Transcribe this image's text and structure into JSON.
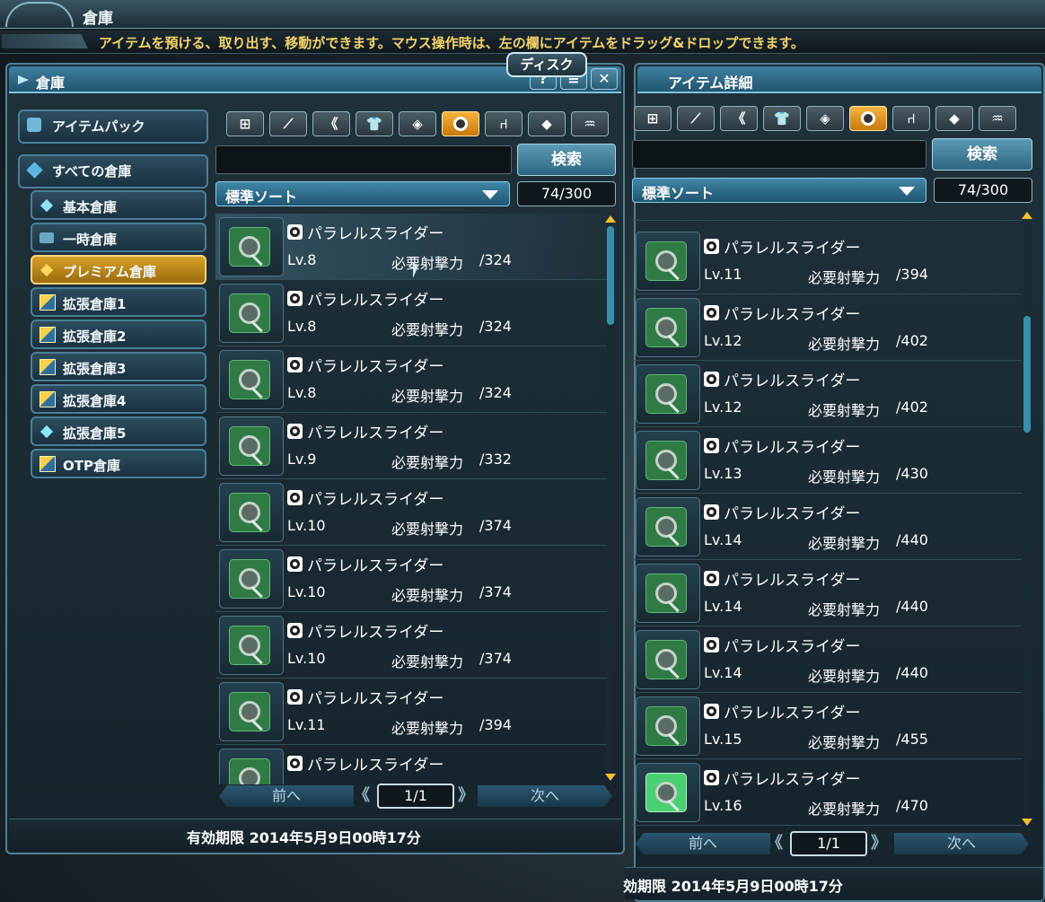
{
  "topbar": {
    "title": "倉庫"
  },
  "info": {
    "text": "アイテムを預ける、取り出す、移動ができます。マウス操作時は、左の欄にアイテムをドラッグ&ドロップできます。"
  },
  "tooltip": {
    "text": "ディスク"
  },
  "left": {
    "title": "倉庫",
    "controls": {
      "help": "?",
      "menu": "≡",
      "close": "✕"
    },
    "sidebar": [
      {
        "label": "アイテムパック",
        "icon": "item-pack-icon"
      },
      {
        "label": "すべての倉庫",
        "icon": "all-storage-icon"
      },
      {
        "label": "基本倉庫",
        "icon": "diamond-icon"
      },
      {
        "label": "一時倉庫",
        "icon": "temp-storage-icon"
      },
      {
        "label": "プレミアム倉庫",
        "icon": "premium-icon",
        "active": true
      },
      {
        "label": "拡張倉庫1",
        "icon": "expansion-icon"
      },
      {
        "label": "拡張倉庫2",
        "icon": "expansion-icon"
      },
      {
        "label": "拡張倉庫3",
        "icon": "expansion-icon"
      },
      {
        "label": "拡張倉庫4",
        "icon": "expansion-icon"
      },
      {
        "label": "拡張倉庫5",
        "icon": "diamond-icon"
      },
      {
        "label": "OTP倉庫",
        "icon": "expansion-icon"
      }
    ],
    "search_button": "検索",
    "sort_label": "標準ソート",
    "count": "74/300",
    "items": [
      {
        "name": "パラレルスライダー",
        "lv": "Lv.8",
        "req": "必要射撃力",
        "val": "/324"
      },
      {
        "name": "パラレルスライダー",
        "lv": "Lv.8",
        "req": "必要射撃力",
        "val": "/324"
      },
      {
        "name": "パラレルスライダー",
        "lv": "Lv.8",
        "req": "必要射撃力",
        "val": "/324"
      },
      {
        "name": "パラレルスライダー",
        "lv": "Lv.9",
        "req": "必要射撃力",
        "val": "/332"
      },
      {
        "name": "パラレルスライダー",
        "lv": "Lv.10",
        "req": "必要射撃力",
        "val": "/374"
      },
      {
        "name": "パラレルスライダー",
        "lv": "Lv.10",
        "req": "必要射撃力",
        "val": "/374"
      },
      {
        "name": "パラレルスライダー",
        "lv": "Lv.10",
        "req": "必要射撃力",
        "val": "/374"
      },
      {
        "name": "パラレルスライダー",
        "lv": "Lv.11",
        "req": "必要射撃力",
        "val": "/394"
      },
      {
        "name": "パラレルスライダー",
        "lv": "",
        "req": "",
        "val": ""
      }
    ],
    "pager": {
      "prev": "前へ",
      "page": "1/1",
      "next": "次へ"
    },
    "expiry": "有効期限 2014年5月9日00時17分"
  },
  "right": {
    "title": "アイテム詳細",
    "search_button": "検索",
    "sort_label": "標準ソート",
    "count": "74/300",
    "items": [
      {
        "name": "パラレルスライダー",
        "lv": "Lv.11",
        "req": "必要射撃力",
        "val": "/394"
      },
      {
        "name": "パラレルスライダー",
        "lv": "Lv.12",
        "req": "必要射撃力",
        "val": "/402"
      },
      {
        "name": "パラレルスライダー",
        "lv": "Lv.12",
        "req": "必要射撃力",
        "val": "/402"
      },
      {
        "name": "パラレルスライダー",
        "lv": "Lv.13",
        "req": "必要射撃力",
        "val": "/430"
      },
      {
        "name": "パラレルスライダー",
        "lv": "Lv.14",
        "req": "必要射撃力",
        "val": "/440"
      },
      {
        "name": "パラレルスライダー",
        "lv": "Lv.14",
        "req": "必要射撃力",
        "val": "/440"
      },
      {
        "name": "パラレルスライダー",
        "lv": "Lv.14",
        "req": "必要射撃力",
        "val": "/440"
      },
      {
        "name": "パラレルスライダー",
        "lv": "Lv.15",
        "req": "必要射撃力",
        "val": "/455"
      },
      {
        "name": "パラレルスライダー",
        "lv": "Lv.16",
        "req": "必要射撃力",
        "val": "/470"
      }
    ],
    "pager": {
      "prev": "前へ",
      "page": "1/1",
      "next": "次へ"
    },
    "expiry": "効期限 2014年5月9日00時17分"
  },
  "tabs": [
    {
      "icon": "all-grid-icon",
      "glyph": "⊞"
    },
    {
      "icon": "sword-icon",
      "glyph": "⟋"
    },
    {
      "icon": "twin-blade-icon",
      "glyph": "《"
    },
    {
      "icon": "shirt-icon",
      "glyph": "👕"
    },
    {
      "icon": "tag-icon",
      "glyph": "◈"
    },
    {
      "icon": "disc-icon",
      "glyph": "",
      "active": true
    },
    {
      "icon": "chair-icon",
      "glyph": "⑁"
    },
    {
      "icon": "diamond-arrow-icon",
      "glyph": "◆"
    },
    {
      "icon": "bag-icon",
      "glyph": "♒"
    }
  ]
}
